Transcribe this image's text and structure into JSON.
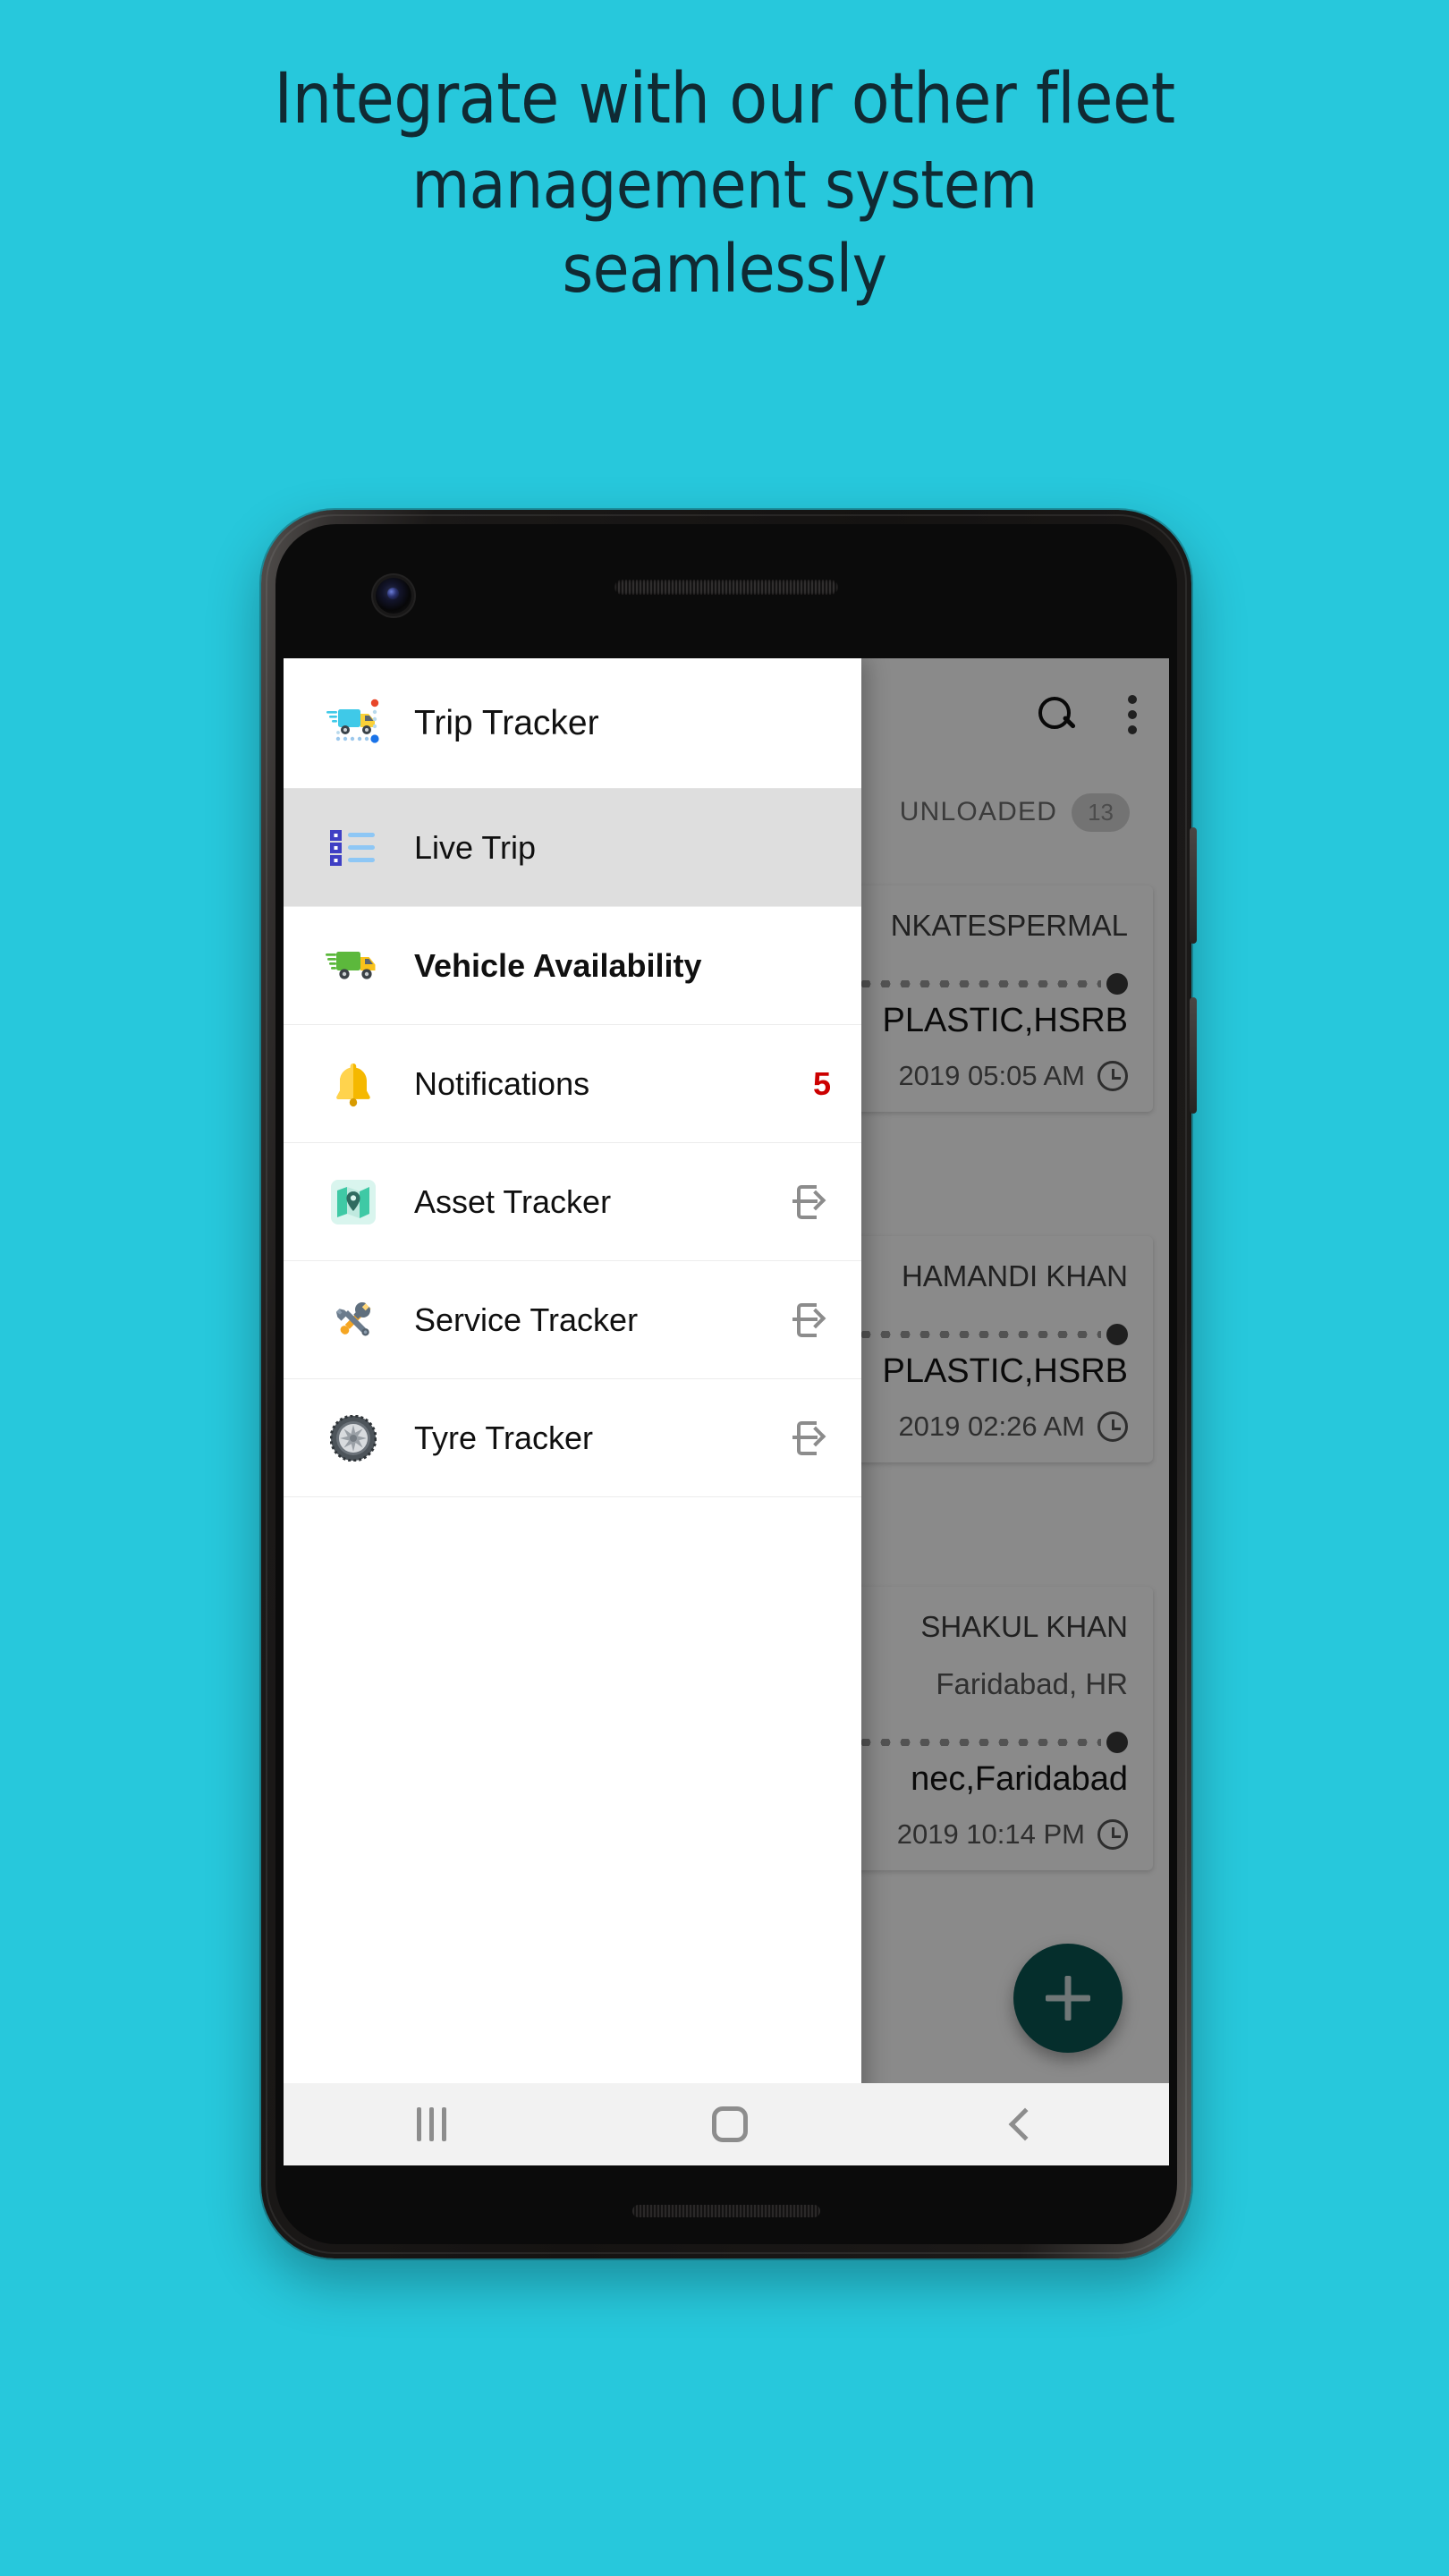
{
  "headline": {
    "line1": "Integrate with our other fleet",
    "line2": "management system",
    "line3": "seamlessly"
  },
  "colors": {
    "background": "#27c8dc",
    "headline_text": "#102a33",
    "fab": "#0a5552",
    "badge_red": "#cc0000",
    "selected_row": "#dedede"
  },
  "drawer": {
    "header": {
      "title": "Trip Tracker",
      "icon": "delivery-truck-tracking-icon"
    },
    "items": [
      {
        "label": "Live Trip",
        "icon": "list-view-icon",
        "selected": true,
        "badge": null,
        "trailing": null,
        "bold": false
      },
      {
        "label": "Vehicle Availability",
        "icon": "green-truck-icon",
        "selected": false,
        "badge": null,
        "trailing": null,
        "bold": true
      },
      {
        "label": "Notifications",
        "icon": "bell-icon",
        "selected": false,
        "badge": "5",
        "trailing": null,
        "bold": false
      },
      {
        "label": "Asset Tracker",
        "icon": "map-location-icon",
        "selected": false,
        "badge": null,
        "trailing": "open-external-icon",
        "bold": false
      },
      {
        "label": "Service Tracker",
        "icon": "tools-wrench-icon",
        "selected": false,
        "badge": null,
        "trailing": "open-external-icon",
        "bold": false
      },
      {
        "label": "Tyre Tracker",
        "icon": "tyre-wheel-icon",
        "selected": false,
        "badge": null,
        "trailing": "open-external-icon",
        "bold": false
      }
    ]
  },
  "app": {
    "appbar": {
      "search_icon": "search-icon",
      "overflow_icon": "more-vertical-icon"
    },
    "tab": {
      "label": "UNLOADED",
      "badge": "13"
    },
    "fab": {
      "icon": "plus-icon"
    },
    "cards": [
      {
        "name": "NKATESPERMAL",
        "sub": "",
        "destination": "PLASTIC,HSRB",
        "time": "2019 05:05 AM"
      },
      {
        "name": "HAMANDI KHAN",
        "sub": "",
        "destination": "PLASTIC,HSRB",
        "time": "2019 02:26 AM"
      },
      {
        "name": "SHAKUL KHAN",
        "sub": "Faridabad, HR",
        "destination": "nec,Faridabad",
        "time": "2019 10:14 PM"
      }
    ]
  },
  "navbar": {
    "recent_label": "recent-apps-button",
    "home_label": "home-button",
    "back_label": "back-button"
  }
}
